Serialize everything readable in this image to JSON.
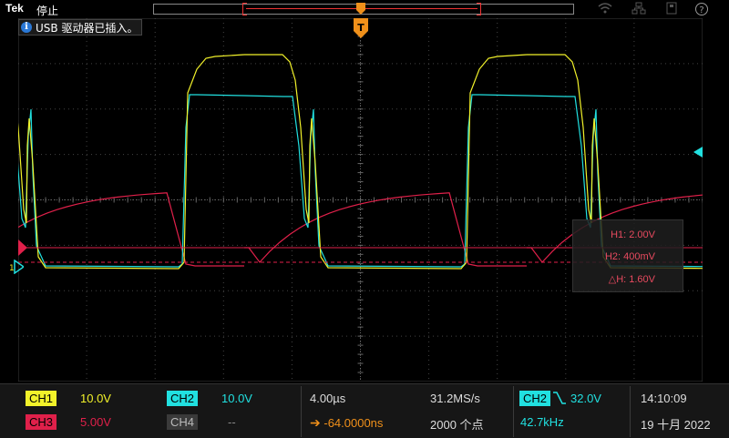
{
  "brand": "Tek",
  "run_state": "停止",
  "message": "USB 驱动器已插入。",
  "trigger_marker": "T",
  "ch1_marker": "1",
  "cursor_readouts": {
    "h1": "H1: 2.00V",
    "h2": "H2: 400mV",
    "delta": "△H: 1.60V"
  },
  "channels": [
    {
      "name": "CH1",
      "scale": "10.0V",
      "color": "#f2f22a"
    },
    {
      "name": "CH2",
      "scale": "10.0V",
      "color": "#21e0e0"
    },
    {
      "name": "CH3",
      "scale": "5.00V",
      "color": "#e0204a"
    },
    {
      "name": "CH4",
      "scale": "--",
      "color": "#888888"
    }
  ],
  "timebase": {
    "scale": "4.00µs",
    "sample_rate": "31.2MS/s",
    "delay": "-64.0000ns",
    "record_length": "2000 个点"
  },
  "trigger": {
    "source": "CH2",
    "slope_icon": "falling-edge-icon",
    "level": "32.0V",
    "frequency": "42.7kHz"
  },
  "clock": {
    "time": "14:10:09",
    "date": "19 十月 2022"
  },
  "icons": [
    "wifi-icon",
    "network-icon",
    "usb-drive-icon",
    "help-icon"
  ]
}
